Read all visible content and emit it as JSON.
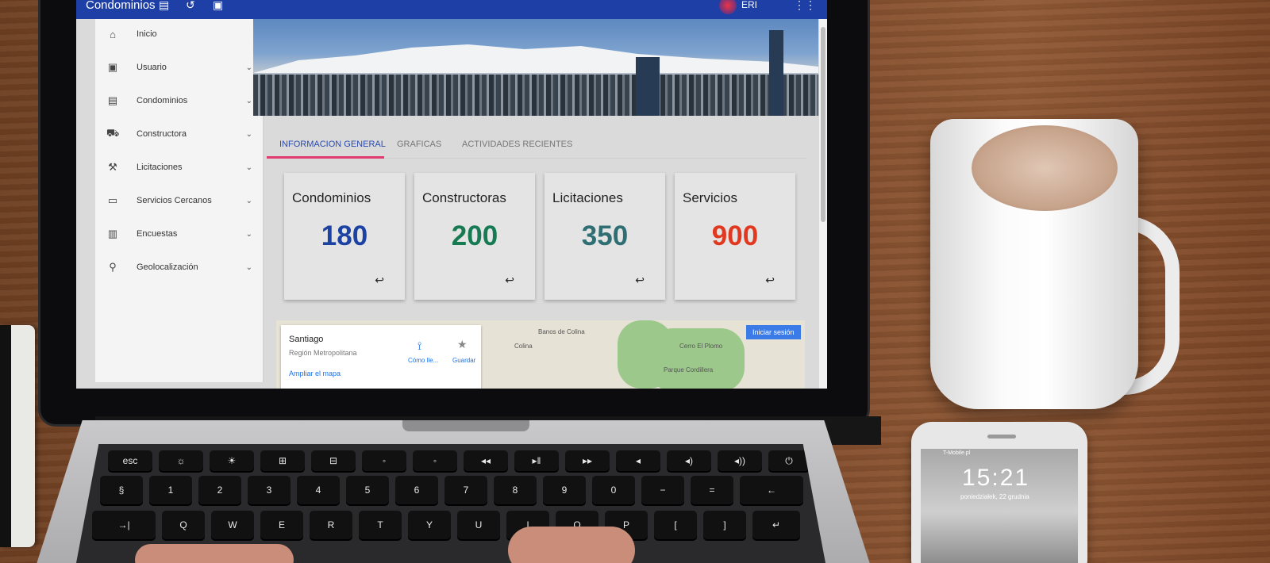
{
  "app": {
    "title": "Condominios",
    "user": "ERI",
    "sidebar": [
      {
        "icon": "home-icon",
        "glyph": "⌂",
        "label": "Inicio"
      },
      {
        "icon": "user-icon",
        "glyph": "▣",
        "label": "Usuario"
      },
      {
        "icon": "building-icon",
        "glyph": "▤",
        "label": "Condominios"
      },
      {
        "icon": "truck-icon",
        "glyph": "⛟",
        "label": "Constructora"
      },
      {
        "icon": "gavel-icon",
        "glyph": "⚒",
        "label": "Licitaciones"
      },
      {
        "icon": "laptop-icon",
        "glyph": "▭",
        "label": "Servicios Cercanos"
      },
      {
        "icon": "chart-icon",
        "glyph": "▥",
        "label": "Encuestas"
      },
      {
        "icon": "pin-icon",
        "glyph": "⚲",
        "label": "Geolocalización"
      }
    ],
    "tabs": [
      {
        "label": "INFORMACION GENERAL",
        "active": true
      },
      {
        "label": "GRAFICAS",
        "active": false
      },
      {
        "label": "ACTIVIDADES RECIENTES",
        "active": false
      }
    ],
    "cards": [
      {
        "title": "Condominios",
        "value": "180",
        "color": "#1c43a3"
      },
      {
        "title": "Constructoras",
        "value": "200",
        "color": "#167a52"
      },
      {
        "title": "Licitaciones",
        "value": "350",
        "color": "#2f6f74"
      },
      {
        "title": "Servicios",
        "value": "900",
        "color": "#e0391f"
      }
    ],
    "map": {
      "place": "Santiago",
      "region": "Región Metropolitana",
      "enlarge": "Ampliar el mapa",
      "directions": "Cómo lle...",
      "save": "Guardar",
      "signin": "Iniciar sesión",
      "labels": [
        "Banos de Colina",
        "Colina",
        "Cerro El Plomo",
        "Parque Cordillera"
      ]
    }
  },
  "phone": {
    "carrier": "T-Mobile.pl",
    "time": "15:21",
    "date": "poniedziałek, 22 grudnia"
  }
}
